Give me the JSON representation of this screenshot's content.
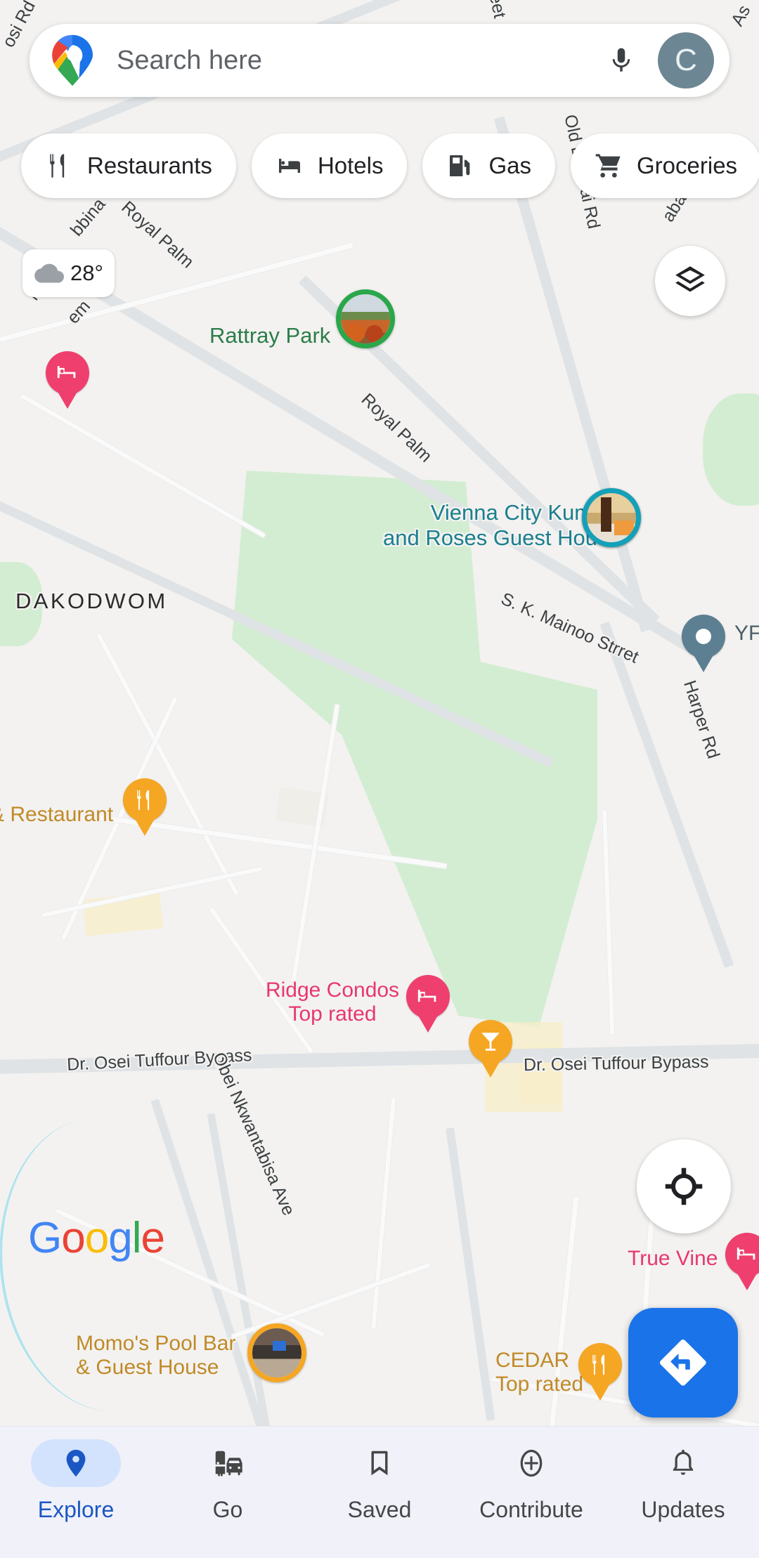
{
  "app": {
    "name": "Google Maps",
    "logo_icon": "google-maps-pin-logo"
  },
  "search": {
    "placeholder": "Search here",
    "value": "",
    "mic_icon": "microphone-icon",
    "avatar_initial": "C"
  },
  "chips": [
    {
      "label": "Restaurants",
      "icon": "restaurant-fork-knife-icon"
    },
    {
      "label": "Hotels",
      "icon": "hotel-bed-icon"
    },
    {
      "label": "Gas",
      "icon": "gas-pump-icon"
    },
    {
      "label": "Groceries",
      "icon": "shopping-cart-icon"
    }
  ],
  "weather": {
    "temperature": "28°",
    "icon": "cloud-icon"
  },
  "controls": {
    "layers_icon": "layers-icon",
    "locate_icon": "my-location-crosshair-icon",
    "directions_icon": "directions-arrow-icon"
  },
  "watermark": {
    "g": "G",
    "o1": "o",
    "o2": "o",
    "g2": "g",
    "l": "l",
    "e": "e"
  },
  "map": {
    "neighborhoods": [
      {
        "name": "DAKODWOM"
      }
    ],
    "streets": [
      {
        "name": "Royal Palm"
      },
      {
        "name": "Royal Palm"
      },
      {
        "name": "Old Bekwai Rd"
      },
      {
        "name": "S. K. Mainoo Strret"
      },
      {
        "name": "Harper Rd"
      },
      {
        "name": "Dr. Osei Tuffour Bypass"
      },
      {
        "name": "Dr. Osei Tuffour Bypass"
      },
      {
        "name": "Obei Nkwantabisa Ave"
      },
      {
        "name": "osi Rd"
      },
      {
        "name": "bbina"
      },
      {
        "name": "em"
      },
      {
        "name": "Mi"
      },
      {
        "name": "aba Rd"
      },
      {
        "name": "As"
      },
      {
        "name": "eet"
      }
    ],
    "places": [
      {
        "name": "Rattray Park",
        "type": "park",
        "marker": "photo-pin-green"
      },
      {
        "name": "Vienna City Kumasi and Roses Guest House",
        "line1": "Vienna City Kumasi",
        "line2": "and Roses Guest House",
        "type": "lodging",
        "marker": "photo-pin-teal"
      },
      {
        "name": "Ridge Condos",
        "badge": "Top rated",
        "type": "lodging",
        "marker": "pin-pink-bed"
      },
      {
        "name": "True Vine",
        "type": "lodging",
        "marker": "pin-pink-bed"
      },
      {
        "name": "CEDAR",
        "badge": "Top rated",
        "type": "restaurant",
        "marker": "pin-orange-restaurant"
      },
      {
        "name": "Momo's Pool Bar & Guest House",
        "line1": "Momo's Pool Bar",
        "line2": "& Guest House",
        "type": "bar",
        "marker": "photo-pin-orange"
      },
      {
        "name": "& Restaurant",
        "type": "restaurant",
        "marker": "pin-orange-restaurant"
      },
      {
        "name": "YF",
        "type": "generic",
        "marker": "pin-slate-dot"
      }
    ]
  },
  "bottom_nav": {
    "items": [
      {
        "label": "Explore",
        "icon": "map-pin-icon",
        "active": true
      },
      {
        "label": "Go",
        "icon": "commute-car-icon",
        "active": false
      },
      {
        "label": "Saved",
        "icon": "bookmark-icon",
        "active": false
      },
      {
        "label": "Contribute",
        "icon": "plus-circle-icon",
        "active": false
      },
      {
        "label": "Updates",
        "icon": "bell-icon",
        "active": false
      }
    ]
  },
  "colors": {
    "accent_blue": "#1a73e8",
    "park_green": "#cdeccd",
    "park_label": "#2c7d4a",
    "teal": "#1a7f8e",
    "pink": "#ef3f6e",
    "orange": "#f5a623",
    "slate": "#5d7f92"
  }
}
